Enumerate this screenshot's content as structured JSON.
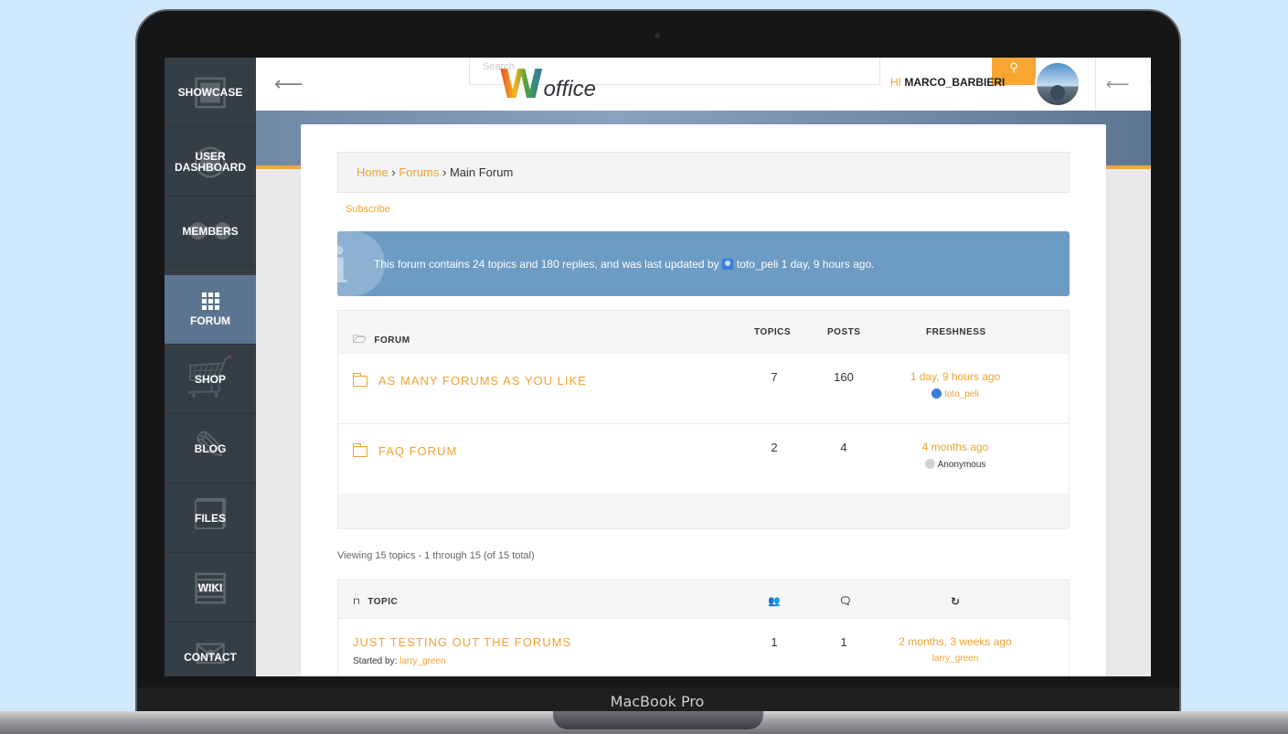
{
  "device_label": "MacBook Pro",
  "sidebar": {
    "items": [
      {
        "label": "SHOWCASE",
        "icon": "cubes-icon"
      },
      {
        "label": "USER DASHBOARD",
        "icon": "dashboard-icon"
      },
      {
        "label": "MEMBERS",
        "icon": "users-icon"
      },
      {
        "label": "FORUM",
        "icon": "grid-icon"
      },
      {
        "label": "SHOP",
        "icon": "cart-icon"
      },
      {
        "label": "BLOG",
        "icon": "pencil-icon"
      },
      {
        "label": "FILES",
        "icon": "files-icon"
      },
      {
        "label": "WIKI",
        "icon": "archive-icon"
      },
      {
        "label": "CONTACT",
        "icon": "envelope-icon"
      }
    ],
    "active_index": 3
  },
  "header": {
    "search_placeholder": "Search",
    "logo_letter": "W",
    "logo_text": "office",
    "greeting_prefix": "HI",
    "username": "MARCO_BARBIERI",
    "greeting_suffix": "!"
  },
  "breadcrumb": {
    "home": "Home",
    "separator": "›",
    "forums": "Forums",
    "current": "Main Forum"
  },
  "subscribe_label": "Subscribe",
  "info": {
    "text_before": "This forum contains 24 topics and 180 replies, and was last updated by",
    "user": "toto_peli",
    "text_after": "1 day, 9 hours ago."
  },
  "forum_table": {
    "headers": {
      "forum": "FORUM",
      "topics": "TOPICS",
      "posts": "POSTS",
      "freshness": "FRESHNESS"
    },
    "rows": [
      {
        "name": "AS MANY FORUMS AS YOU LIKE",
        "topics": "7",
        "posts": "160",
        "freshness": "1 day, 9 hours ago",
        "user": "toto_peli"
      },
      {
        "name": "FAQ FORUM",
        "topics": "2",
        "posts": "4",
        "freshness": "4 months ago",
        "user": "Anonymous"
      }
    ]
  },
  "viewing_text": "Viewing 15 topics - 1 through 15 (of 15 total)",
  "topic_table": {
    "headers": {
      "topic": "TOPIC"
    },
    "rows": [
      {
        "title": "JUST TESTING OUT THE FORUMS",
        "started_by_label": "Started by:",
        "author": "larry_green",
        "voices": "1",
        "posts": "1",
        "freshness": "2 months, 3 weeks ago",
        "last_user": "larry_green"
      }
    ]
  },
  "colors": {
    "accent": "#f0a330",
    "sidebar": "#353d45",
    "sidebar_active": "#5b7590",
    "info": "#6c9bc4"
  }
}
